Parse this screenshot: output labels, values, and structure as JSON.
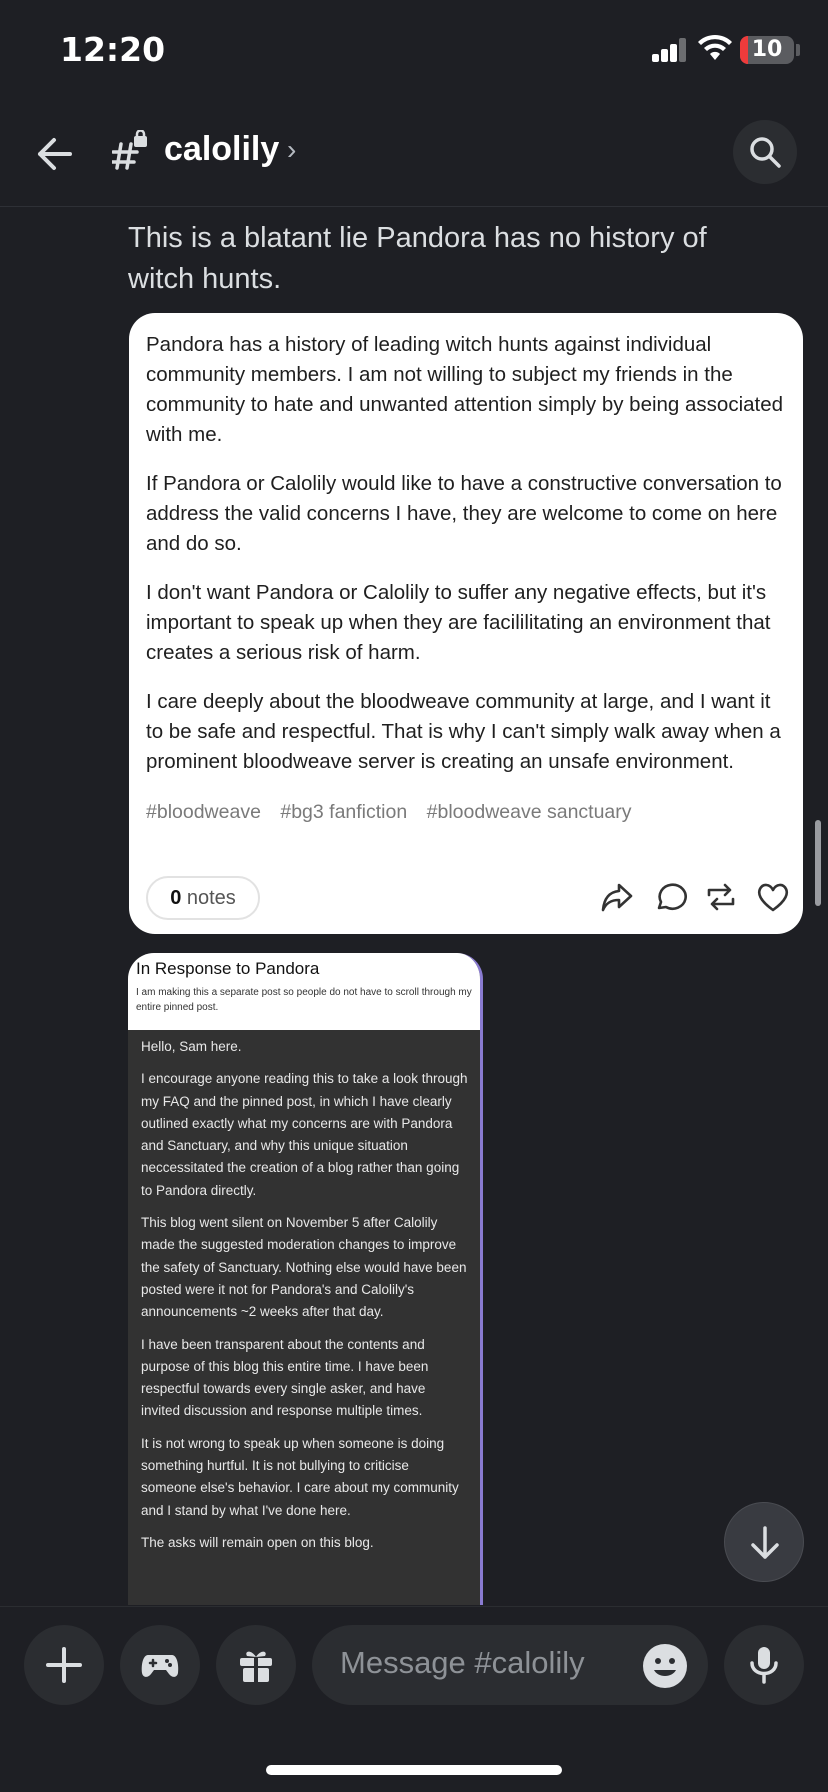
{
  "status_bar": {
    "time": "12:20",
    "battery": "10"
  },
  "header": {
    "channel_name": "calolily",
    "chevron": "›"
  },
  "message": {
    "text": "This is a blatant lie Pandora has no history of witch hunts."
  },
  "card": {
    "paragraphs": [
      "Pandora has a history of leading witch hunts against individual community members. I am not willing to subject my friends in the community to hate and unwanted attention simply by being associated with me.",
      "If Pandora or Calolily would like to have a constructive conversation to address the valid concerns I have, they are welcome to come on here and do so.",
      "I don't want Pandora or Calolily to suffer any negative effects, but it's important to speak up when they are facililitating an environment that creates a serious risk of harm.",
      "I care deeply about the bloodweave community at large, and I want it to be safe and respectful. That is why I can't simply walk away when a prominent bloodweave server is creating an unsafe environment."
    ],
    "tags": [
      "#bloodweave",
      "#bg3 fanfiction",
      "#bloodweave sanctuary"
    ],
    "notes_count": "0",
    "notes_label": "notes"
  },
  "image_post": {
    "title": "In Response to Pandora",
    "subtitle": "I am making this a separate post so people do not have to scroll through my entire pinned post.",
    "paragraphs": [
      "Hello, Sam here.",
      "I encourage anyone reading this to take a look through my FAQ and the pinned post, in which I have clearly outlined exactly what my concerns are with Pandora and Sanctuary, and why this unique situation neccessitated the creation of a blog rather than going to Pandora directly.",
      "This blog went silent on November 5 after Calolily made the suggested moderation changes to improve the safety of Sanctuary. Nothing else would have been posted were it not for Pandora's and Calolily's announcements ~2 weeks after that day.",
      "I have been transparent about the contents and purpose of this blog this entire time. I have been respectful towards every single asker, and have invited discussion and response multiple times.",
      "It is not wrong to speak up when someone is doing something hurtful. It is not bullying to criticise someone else's behavior. I care about my community and I stand by what I've done here.",
      "The asks will remain open on this blog."
    ]
  },
  "composer": {
    "placeholder": "Message #calolily"
  },
  "icons": {
    "back": "arrow-left-icon",
    "channel": "locked-hashtag-icon",
    "search": "search-icon",
    "share": "share-icon",
    "reply": "reply-icon",
    "reblog": "reblog-icon",
    "like": "heart-icon",
    "jump": "arrow-down-icon",
    "add": "plus-icon",
    "games": "gamepad-icon",
    "gift": "gift-icon",
    "emoji": "emoji-icon",
    "mic": "microphone-icon"
  }
}
